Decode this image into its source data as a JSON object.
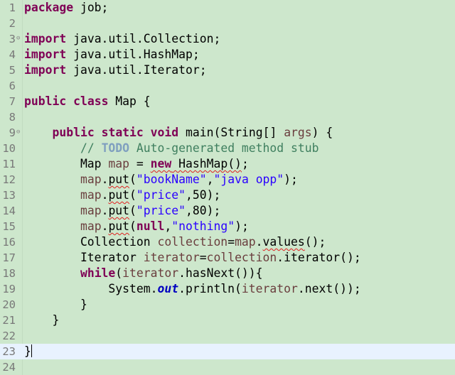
{
  "editor": {
    "lines": [
      {
        "n": "1",
        "fold": "",
        "tokens": [
          {
            "t": "package",
            "c": "kw"
          },
          {
            "t": " job;"
          }
        ]
      },
      {
        "n": "2",
        "fold": "",
        "tokens": []
      },
      {
        "n": "3",
        "fold": "⊖",
        "tokens": [
          {
            "t": "import",
            "c": "kw"
          },
          {
            "t": " java.util.Collection;"
          }
        ]
      },
      {
        "n": "4",
        "fold": "",
        "tokens": [
          {
            "t": "import",
            "c": "kw"
          },
          {
            "t": " java.util.HashMap;"
          }
        ]
      },
      {
        "n": "5",
        "fold": "",
        "tokens": [
          {
            "t": "import",
            "c": "kw"
          },
          {
            "t": " java.util.Iterator;"
          }
        ]
      },
      {
        "n": "6",
        "fold": "",
        "tokens": []
      },
      {
        "n": "7",
        "fold": "",
        "tokens": [
          {
            "t": "public",
            "c": "kw"
          },
          {
            "t": " "
          },
          {
            "t": "class",
            "c": "kw"
          },
          {
            "t": " Map {"
          }
        ]
      },
      {
        "n": "8",
        "fold": "",
        "tokens": []
      },
      {
        "n": "9",
        "fold": "⊖",
        "tokens": [
          {
            "t": "    "
          },
          {
            "t": "public",
            "c": "kw"
          },
          {
            "t": " "
          },
          {
            "t": "static",
            "c": "kw"
          },
          {
            "t": " "
          },
          {
            "t": "void",
            "c": "kw"
          },
          {
            "t": " main(String[] "
          },
          {
            "t": "args",
            "c": "var"
          },
          {
            "t": ") {"
          }
        ]
      },
      {
        "n": "10",
        "fold": "",
        "tokens": [
          {
            "t": "        "
          },
          {
            "t": "// ",
            "c": "cm"
          },
          {
            "t": "TODO",
            "c": "todo"
          },
          {
            "t": " Auto-generated method stub",
            "c": "cm"
          }
        ]
      },
      {
        "n": "11",
        "fold": "",
        "tokens": [
          {
            "t": "        Map "
          },
          {
            "t": "map",
            "c": "var"
          },
          {
            "t": " = "
          },
          {
            "t": "new",
            "c": "kw sq"
          },
          {
            "t": " HashMap()",
            "c": "sq"
          },
          {
            "t": ";"
          }
        ]
      },
      {
        "n": "12",
        "fold": "",
        "tokens": [
          {
            "t": "        "
          },
          {
            "t": "map",
            "c": "var"
          },
          {
            "t": "."
          },
          {
            "t": "put",
            "c": "sq"
          },
          {
            "t": "("
          },
          {
            "t": "\"bookName\"",
            "c": "str"
          },
          {
            "t": ","
          },
          {
            "t": "\"java opp\"",
            "c": "str"
          },
          {
            "t": ");"
          }
        ]
      },
      {
        "n": "13",
        "fold": "",
        "tokens": [
          {
            "t": "        "
          },
          {
            "t": "map",
            "c": "var"
          },
          {
            "t": "."
          },
          {
            "t": "put",
            "c": "sq"
          },
          {
            "t": "("
          },
          {
            "t": "\"price\"",
            "c": "str"
          },
          {
            "t": ",50);"
          }
        ]
      },
      {
        "n": "14",
        "fold": "",
        "tokens": [
          {
            "t": "        "
          },
          {
            "t": "map",
            "c": "var"
          },
          {
            "t": "."
          },
          {
            "t": "put",
            "c": "sq"
          },
          {
            "t": "("
          },
          {
            "t": "\"price\"",
            "c": "str"
          },
          {
            "t": ",80);"
          }
        ]
      },
      {
        "n": "15",
        "fold": "",
        "tokens": [
          {
            "t": "        "
          },
          {
            "t": "map",
            "c": "var"
          },
          {
            "t": "."
          },
          {
            "t": "put",
            "c": "sq"
          },
          {
            "t": "("
          },
          {
            "t": "null",
            "c": "kw"
          },
          {
            "t": ","
          },
          {
            "t": "\"nothing\"",
            "c": "str"
          },
          {
            "t": ");"
          }
        ]
      },
      {
        "n": "16",
        "fold": "",
        "tokens": [
          {
            "t": "        Collection "
          },
          {
            "t": "collection",
            "c": "var"
          },
          {
            "t": "="
          },
          {
            "t": "map",
            "c": "var"
          },
          {
            "t": "."
          },
          {
            "t": "values",
            "c": "sq"
          },
          {
            "t": "();"
          }
        ]
      },
      {
        "n": "17",
        "fold": "",
        "tokens": [
          {
            "t": "        Iterator "
          },
          {
            "t": "iterator",
            "c": "var"
          },
          {
            "t": "="
          },
          {
            "t": "collection",
            "c": "var"
          },
          {
            "t": ".iterator();"
          }
        ]
      },
      {
        "n": "18",
        "fold": "",
        "tokens": [
          {
            "t": "        "
          },
          {
            "t": "while",
            "c": "kw"
          },
          {
            "t": "("
          },
          {
            "t": "iterator",
            "c": "var"
          },
          {
            "t": ".hasNext()){"
          }
        ]
      },
      {
        "n": "19",
        "fold": "",
        "tokens": [
          {
            "t": "            System."
          },
          {
            "t": "out",
            "c": "fld"
          },
          {
            "t": ".println("
          },
          {
            "t": "iterator",
            "c": "var"
          },
          {
            "t": ".next());"
          }
        ]
      },
      {
        "n": "20",
        "fold": "",
        "tokens": [
          {
            "t": "        }"
          }
        ]
      },
      {
        "n": "21",
        "fold": "",
        "tokens": [
          {
            "t": "    }"
          }
        ]
      },
      {
        "n": "22",
        "fold": "",
        "tokens": []
      },
      {
        "n": "23",
        "fold": "",
        "current": true,
        "caret": true,
        "tokens": [
          {
            "t": "}"
          }
        ]
      },
      {
        "n": "24",
        "fold": "",
        "tokens": []
      }
    ]
  }
}
